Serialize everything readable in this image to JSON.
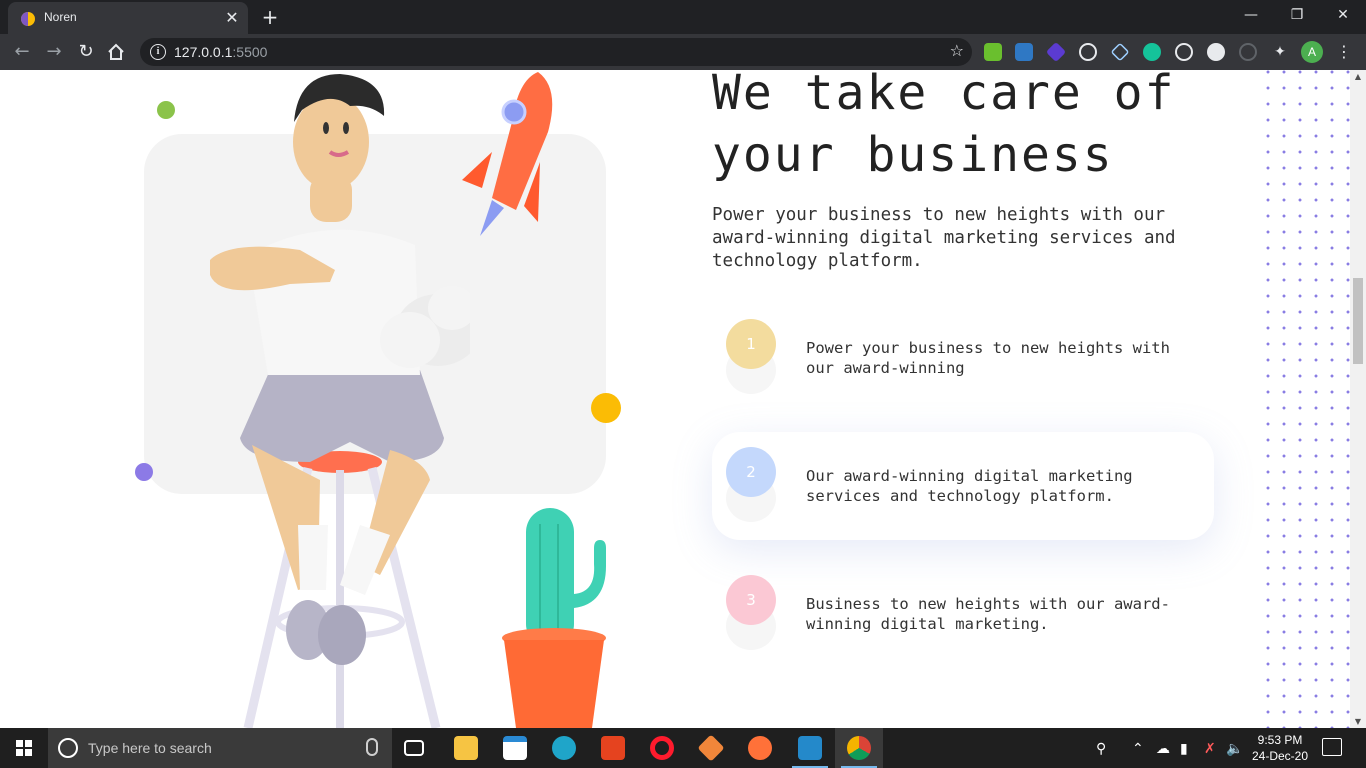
{
  "browser": {
    "tab_title": "Noren",
    "url_host": "127.0.0.1",
    "url_port": ":5500",
    "profile_initial": "A"
  },
  "page": {
    "headline": "We take care of your business",
    "lead": "Power your business to new heights with our award-winning digital marketing services and technology platform.",
    "features": [
      {
        "number": "1",
        "text": "Power your business to new heights with our award-winning",
        "color": "#f3dc9e"
      },
      {
        "number": "2",
        "text": "Our award-winning digital marketing services and technology platform.",
        "color": "#c4d8fc"
      },
      {
        "number": "3",
        "text": "Business to new heights with our award-winning digital marketing.",
        "color": "#fbc8d4"
      }
    ],
    "accent_colors": {
      "green_dot": "#8bc34a",
      "yellow_dot": "#fbbc05",
      "purple_dot": "#8c7ae6",
      "dot_pattern": "#7c6fe0"
    }
  },
  "taskbar": {
    "search_placeholder": "Type here to search",
    "time": "9:53 PM",
    "date": "24-Dec-20",
    "apps": [
      "task-view",
      "file-explorer",
      "microsoft-store",
      "edge",
      "office",
      "opera",
      "git",
      "firefox",
      "vscode",
      "chrome"
    ]
  }
}
